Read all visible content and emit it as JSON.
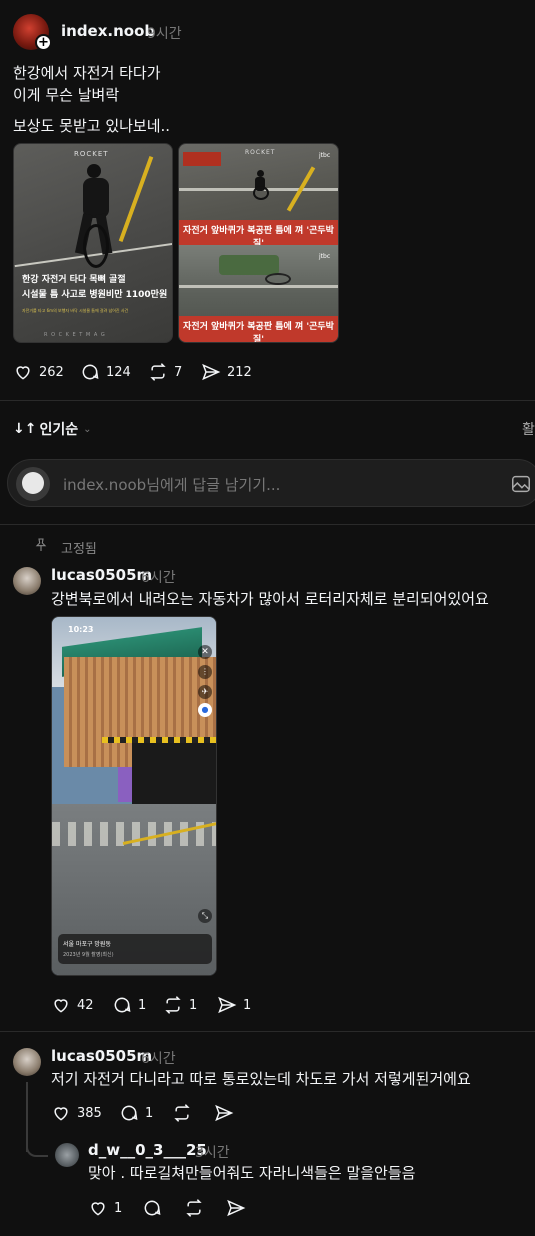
{
  "post": {
    "username": "index.noob",
    "time": "9시간",
    "lines": [
      "한강에서 자전거 타다가",
      "이게 무슨 날벼락",
      "보상도 못받고 있나보네.."
    ],
    "image1": {
      "brand": "ROCKET",
      "caption1": "한강 자전거 타다 목뼈 골절",
      "caption2": "시설물 틈 사고로 병원비만 1100만원",
      "small": "자전거를 타고 6m의 보행자 바닥 시설물 틈에 걸려 넘어진 사건",
      "footer": "R O C K E T M A G"
    },
    "image2": {
      "brand": "ROCKET",
      "tag": "jtbc",
      "banner": "자전거 앞바퀴가 복공판 틈에 껴 '곤두박질'"
    },
    "image3": {
      "tag": "jtbc",
      "banner": "자전거 앞바퀴가 복공판 틈에 껴 '곤두박질'"
    },
    "likes": "262",
    "comments": "124",
    "reposts": "7",
    "shares": "212"
  },
  "sort": {
    "label": "인기순",
    "right_label": "활"
  },
  "reply_box": {
    "placeholder": "index.noob님에게 답글 남기기..."
  },
  "pinned_label": "고정됨",
  "comments": [
    {
      "username": "lucas0505m",
      "time": "6시간",
      "text": "강변북로에서 내려오는 자동차가 많아서 로터리자체로 분리되어있어요",
      "image": {
        "status_time": "10:23",
        "location_title": "서울 마포구 망원동",
        "location_sub": "2023년 9월 촬영(최신)"
      },
      "likes": "42",
      "replies": "1",
      "reposts": "1",
      "shares": "1"
    },
    {
      "username": "lucas0505m",
      "time": "6시간",
      "text": "저기 자전거 다니라고 따로 통로있는데 차도로 가서 저렇게된거에요",
      "likes": "385",
      "replies": "1"
    },
    {
      "username": "d_w__0_3___25",
      "time": "3시간",
      "text": "맞아 . 따로길쳐만들어줘도 자라니색들은 말을안들음",
      "likes": "1"
    }
  ],
  "colors": {
    "background": "#101010",
    "text": "#f3f5f7",
    "muted": "#777777",
    "banner_red": "#c0392b"
  }
}
